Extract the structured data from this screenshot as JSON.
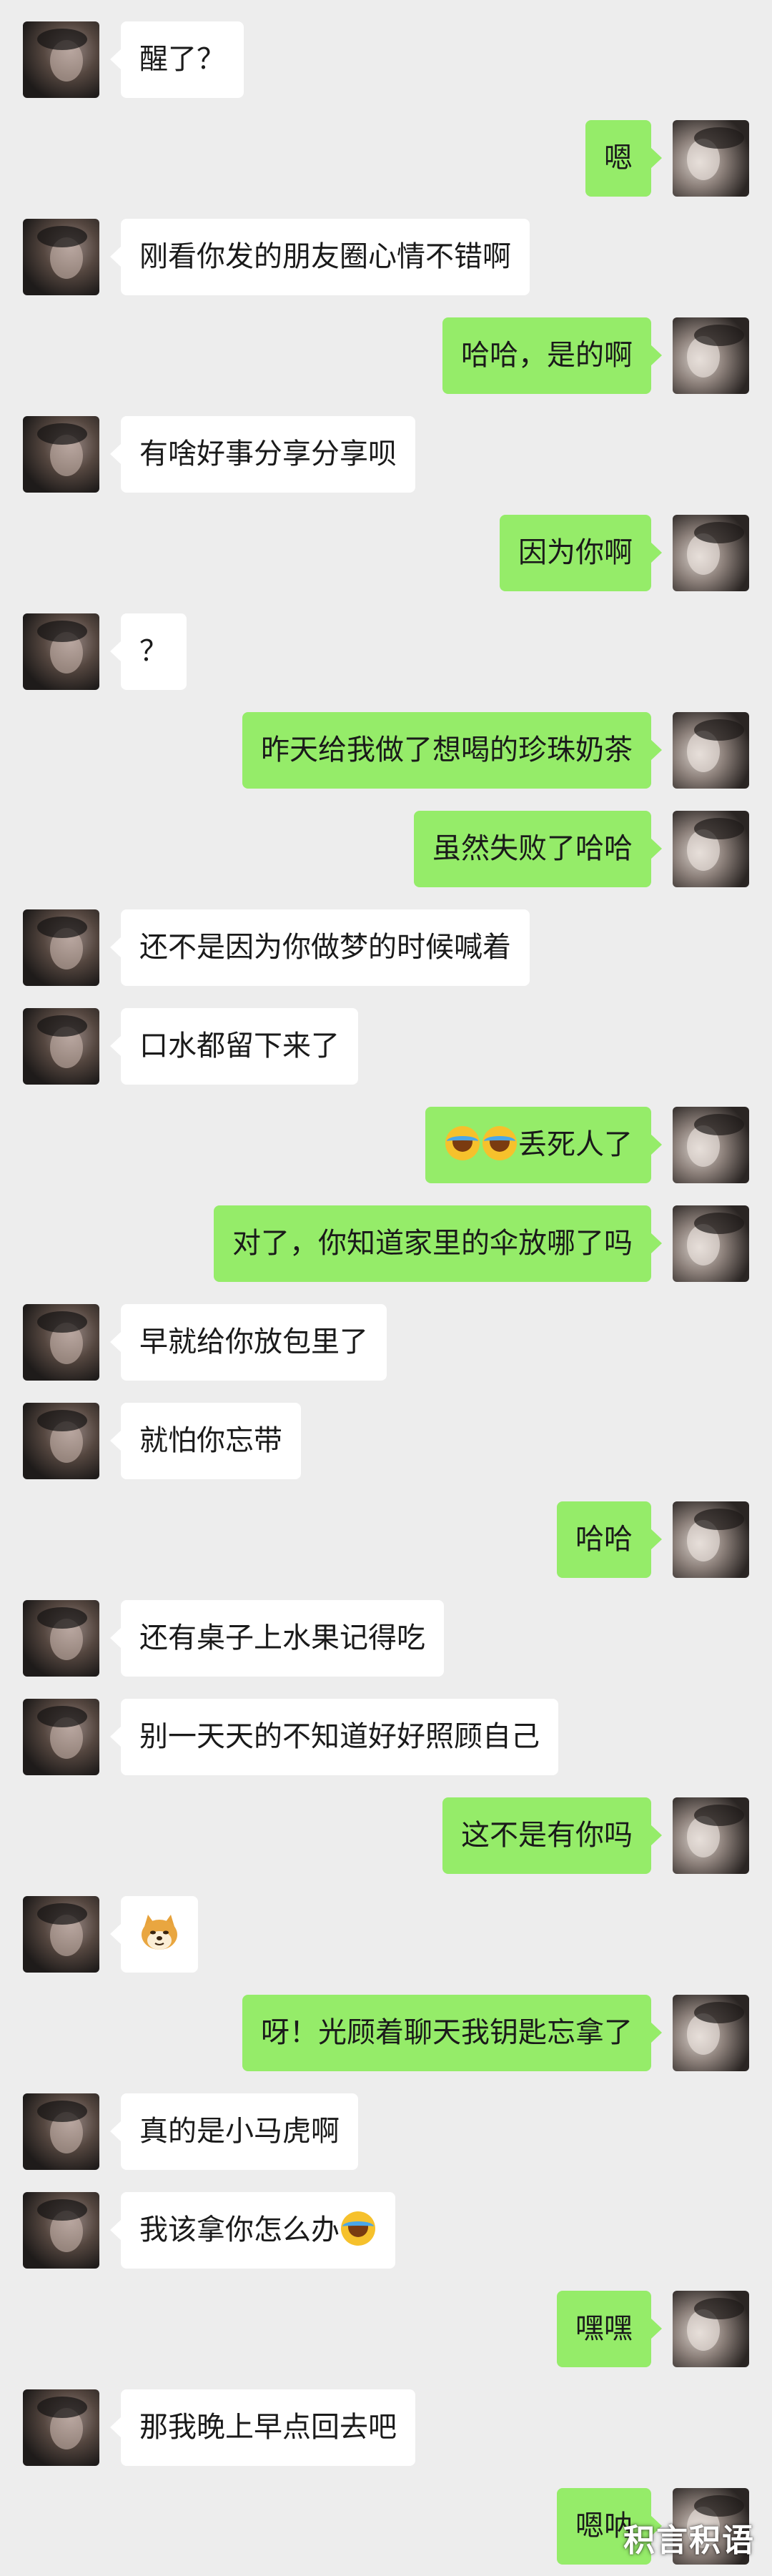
{
  "messages": [
    {
      "side": "left",
      "text": "醒了？"
    },
    {
      "side": "right",
      "text": "嗯"
    },
    {
      "side": "left",
      "text": "刚看你发的朋友圈心情不错啊"
    },
    {
      "side": "right",
      "text": "哈哈，是的啊"
    },
    {
      "side": "left",
      "text": "有啥好事分享分享呗"
    },
    {
      "side": "right",
      "text": "因为你啊"
    },
    {
      "side": "left",
      "text": "？"
    },
    {
      "side": "right",
      "text": "昨天给我做了想喝的珍珠奶茶"
    },
    {
      "side": "right",
      "text": "虽然失败了哈哈"
    },
    {
      "side": "left",
      "text": "还不是因为你做梦的时候喊着"
    },
    {
      "side": "left",
      "text": "口水都留下来了"
    },
    {
      "side": "right",
      "text": "丢死人了",
      "prefix_emoji": "laugh-cry-emoji",
      "prefix_count": 2
    },
    {
      "side": "right",
      "text": "对了，你知道家里的伞放哪了吗"
    },
    {
      "side": "left",
      "text": "早就给你放包里了"
    },
    {
      "side": "left",
      "text": "就怕你忘带"
    },
    {
      "side": "right",
      "text": "哈哈"
    },
    {
      "side": "left",
      "text": "还有桌子上水果记得吃"
    },
    {
      "side": "left",
      "text": "别一天天的不知道好好照顾自己"
    },
    {
      "side": "right",
      "text": "这不是有你吗"
    },
    {
      "side": "left",
      "text": "",
      "sticker": "doge-emoji"
    },
    {
      "side": "right",
      "text": "呀！光顾着聊天我钥匙忘拿了"
    },
    {
      "side": "left",
      "text": "真的是小马虎啊"
    },
    {
      "side": "left",
      "text": "我该拿你怎么办",
      "suffix_emoji": "laugh-cry-emoji",
      "suffix_count": 1
    },
    {
      "side": "right",
      "text": "嘿嘿"
    },
    {
      "side": "left",
      "text": "那我晚上早点回去吧"
    },
    {
      "side": "right",
      "text": "嗯呐"
    }
  ],
  "watermark": "积言积语",
  "colors": {
    "background": "#ededed",
    "bubble_self": "#95ec69",
    "bubble_other": "#ffffff"
  }
}
